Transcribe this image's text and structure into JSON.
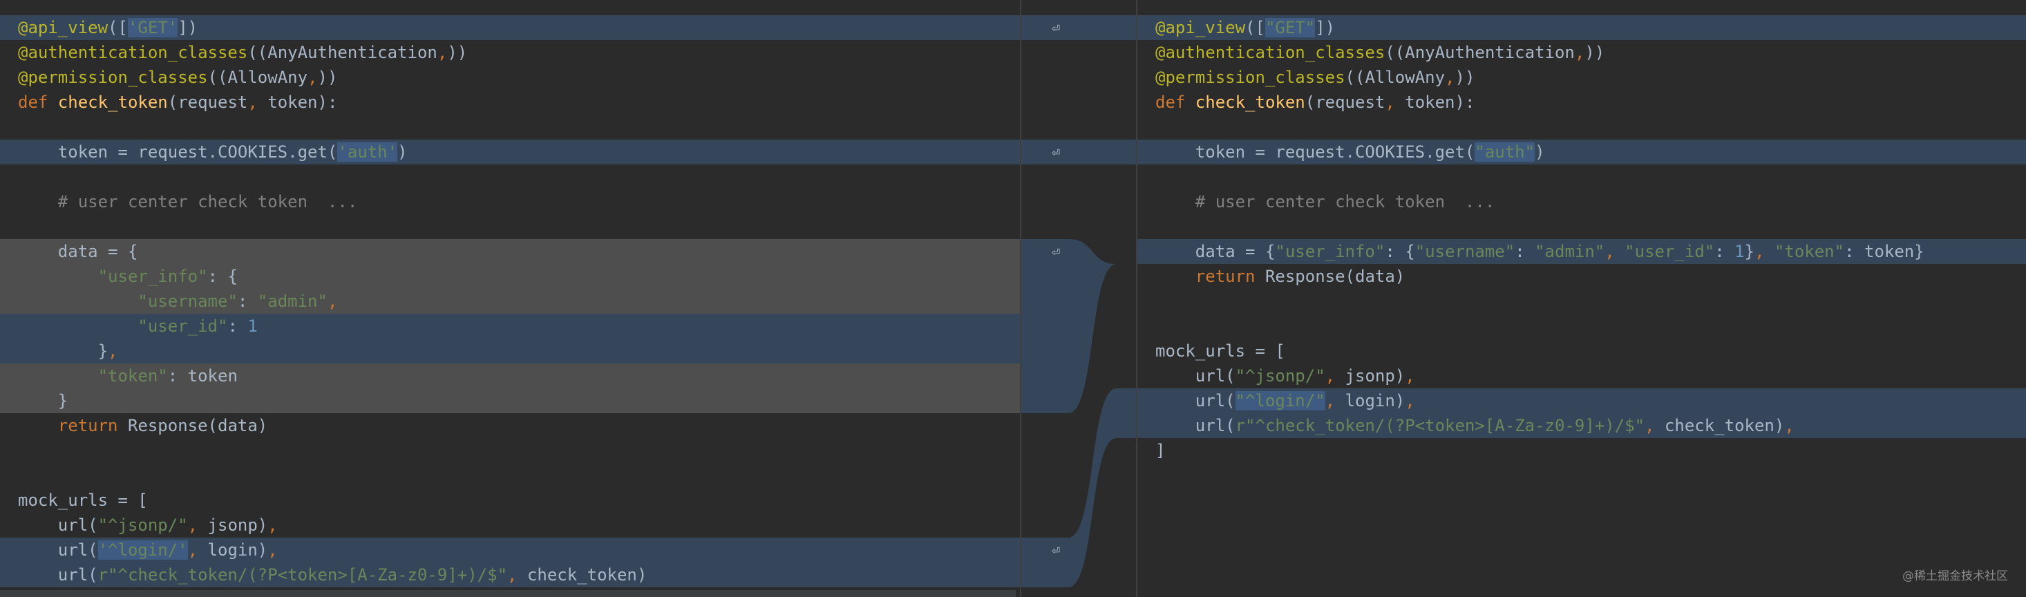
{
  "left": {
    "lines": [
      {
        "text": "@api_view(['GET'])"
      },
      {
        "text": "@authentication_classes((AnyAuthentication,))"
      },
      {
        "text": "@permission_classes((AllowAny,))"
      },
      {
        "text": "def check_token(request, token):"
      },
      {
        "text": ""
      },
      {
        "text": "    token = request.COOKIES.get('auth')"
      },
      {
        "text": ""
      },
      {
        "text": "    # user center check token  ..."
      },
      {
        "text": ""
      },
      {
        "text": "    data = {"
      },
      {
        "text": "        \"user_info\": {"
      },
      {
        "text": "            \"username\": \"admin\","
      },
      {
        "text": "            \"user_id\": 1"
      },
      {
        "text": "        },"
      },
      {
        "text": "        \"token\": token"
      },
      {
        "text": "    }"
      },
      {
        "text": "    return Response(data)"
      },
      {
        "text": ""
      },
      {
        "text": ""
      },
      {
        "text": "mock_urls = ["
      },
      {
        "text": "    url(\"^jsonp/\", jsonp),"
      },
      {
        "text": "    url('^login/', login),"
      },
      {
        "text": "    url(r\"^check_token/(?P<token>[A-Za-z0-9]+)/$\", check_token)"
      }
    ]
  },
  "right": {
    "lines": [
      {
        "text": "@api_view([\"GET\"])"
      },
      {
        "text": "@authentication_classes((AnyAuthentication,))"
      },
      {
        "text": "@permission_classes((AllowAny,))"
      },
      {
        "text": "def check_token(request, token):"
      },
      {
        "text": ""
      },
      {
        "text": "    token = request.COOKIES.get(\"auth\")"
      },
      {
        "text": ""
      },
      {
        "text": "    # user center check token  ..."
      },
      {
        "text": ""
      },
      {
        "text": "    data = {\"user_info\": {\"username\": \"admin\", \"user_id\": 1}, \"token\": token}"
      },
      {
        "text": "    return Response(data)"
      },
      {
        "text": ""
      },
      {
        "text": ""
      },
      {
        "text": "mock_urls = ["
      },
      {
        "text": "    url(\"^jsonp/\", jsonp),"
      },
      {
        "text": "    url(\"^login/\", login),"
      },
      {
        "text": "    url(r\"^check_token/(?P<token>[A-Za-z0-9]+)/$\", check_token),"
      },
      {
        "text": "]"
      }
    ]
  },
  "watermark": "@稀土掘金技术社区",
  "colors": {
    "background": "#2b2b2b",
    "changed": "#35465a",
    "deleted": "#4e4e4e",
    "string": "#6a8759",
    "keyword": "#cc7832",
    "function": "#ffc66d",
    "decorator": "#bbb529"
  }
}
